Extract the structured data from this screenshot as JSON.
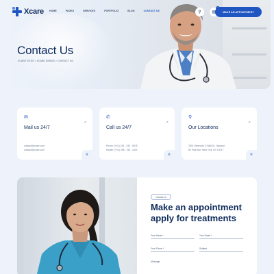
{
  "header": {
    "logo_text": "Xcare",
    "menu": [
      "HOME",
      "PAGES",
      "SERVICES",
      "PORTFOLIO",
      "BLOG",
      "CONTACT US"
    ],
    "active_menu": "CONTACT US",
    "search_icon": "search-icon",
    "cart_icon": "cart-icon",
    "cart_count": "0",
    "cta_label": "MAKE AN APPOINTMENT"
  },
  "hero": {
    "title": "Contact Us",
    "breadcrumb": "XCARE SITES > XCARE DEMOS > CONTACT US"
  },
  "cards": [
    {
      "icon": "mail-icon",
      "title": "Mail us 24/7",
      "lines": [
        "contact@xcare.com",
        "contact@xcare.com"
      ]
    },
    {
      "icon": "phone-icon",
      "title": "Call us 24/7",
      "lines": [
        "Phone: (+01) 234 - 345 - 5678",
        "Mobile: (+01) 098 - 765 - 4321"
      ]
    },
    {
      "icon": "location-icon",
      "title": "Our Locations",
      "lines": [
        "2601 Riverside, 9 Wait St, Oakland",
        "80 Park Ave, New York, NY 10017"
      ]
    }
  ],
  "appointment": {
    "tag": "Contact us",
    "title": "Make an appointment apply for treatments",
    "fields": [
      "Your Name *",
      "Your Email *",
      "Your Phone *",
      "Subject",
      "Message"
    ]
  },
  "colors": {
    "primary": "#1f56c2",
    "heading": "#0e2a5a",
    "background": "#eef3fb"
  }
}
